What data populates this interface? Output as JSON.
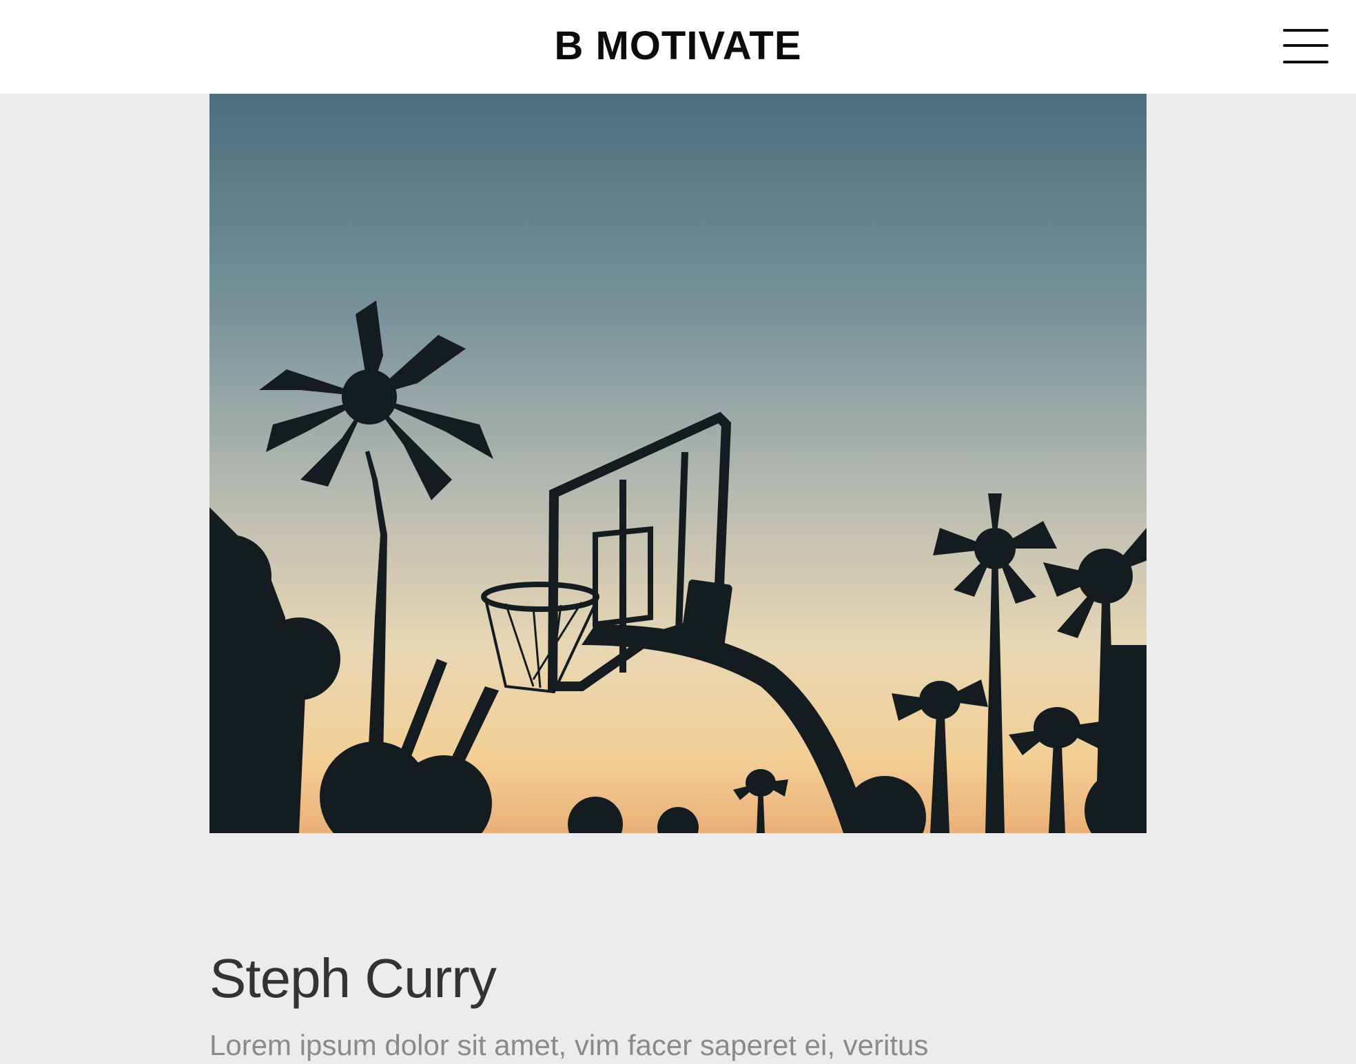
{
  "header": {
    "brand": "B MOTIVATE",
    "menu_icon": "hamburger-menu-icon"
  },
  "hero": {
    "image_icon": "basketball-hoop-sunset-photo"
  },
  "article": {
    "title": "Steph Curry",
    "body": "Lorem ipsum dolor sit amet, vim facer saperet ei, veritus"
  },
  "colors": {
    "background": "#ececec",
    "header_bg": "#ffffff",
    "brand_text": "#0b0b0b",
    "title_text": "#333333",
    "body_text": "#8a8a8a"
  }
}
